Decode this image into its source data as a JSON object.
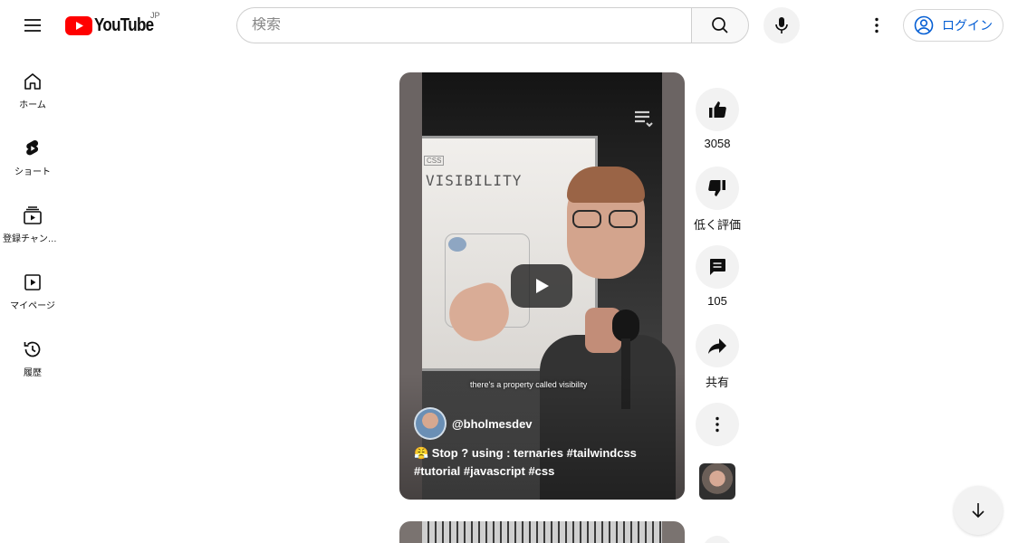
{
  "header": {
    "logo_text": "YouTube",
    "region": "JP",
    "search_placeholder": "検索",
    "login_label": "ログイン"
  },
  "sidebar": {
    "items": [
      {
        "label": "ホーム",
        "icon": "home-icon"
      },
      {
        "label": "ショート",
        "icon": "shorts-icon"
      },
      {
        "label": "登録チャンネル",
        "icon": "subscriptions-icon"
      },
      {
        "label": "マイページ",
        "icon": "library-icon"
      },
      {
        "label": "履歴",
        "icon": "history-icon"
      }
    ]
  },
  "video": {
    "whiteboard_label": "CSS",
    "whiteboard_text": "VISIBILITY",
    "caption": "there's a property called visibility",
    "channel": "@bholmesdev",
    "title": "😤 Stop ? using : ternaries #tailwindcss #tutorial #javascript #css"
  },
  "actions": {
    "like_count": "3058",
    "dislike_label": "低く評価",
    "comment_count": "105",
    "share_label": "共有"
  },
  "colors": {
    "brand_red": "#ff0000",
    "link_blue": "#065fd4",
    "chip_gray": "#f2f2f2"
  }
}
